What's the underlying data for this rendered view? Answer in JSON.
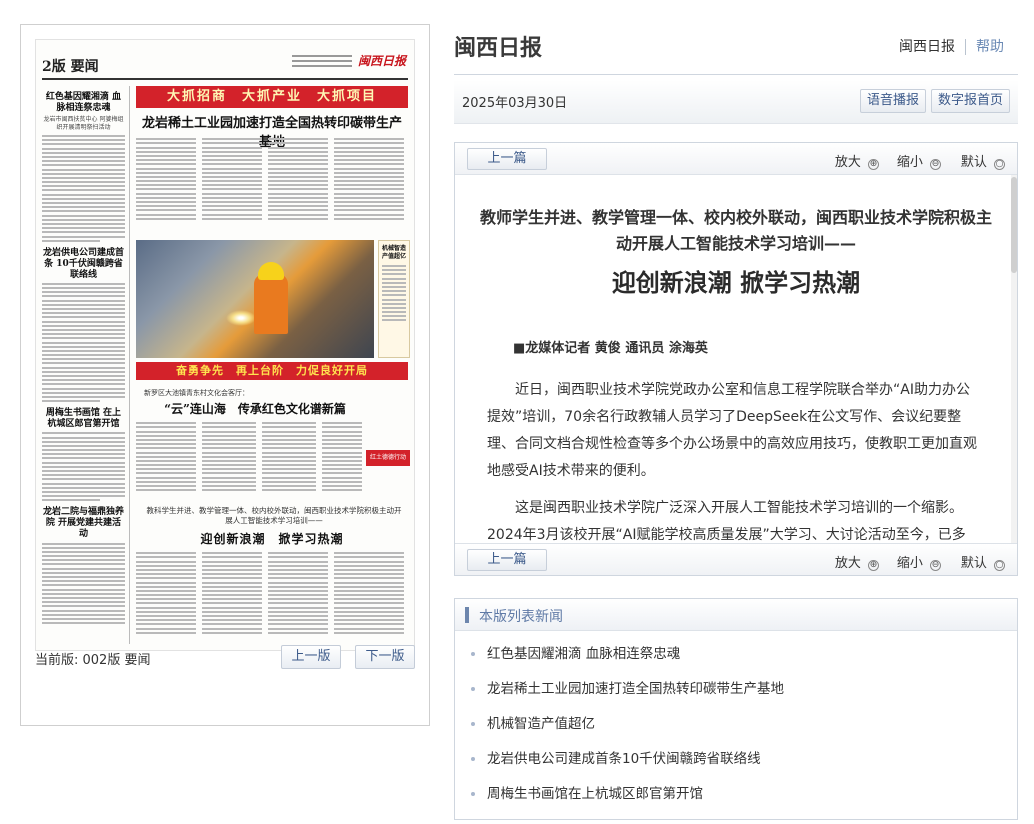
{
  "page_image": {
    "edition": "2版 要闻",
    "logo_text": "闽西日报",
    "col1_articles": [
      {
        "title": "红色基因耀湘滴 血脉相连祭忠魂",
        "sub": "龙岩市闽西扶贫中心 阿婆梅组织开展清明祭扫活动"
      },
      {
        "title": "龙岩供电公司建成首条 10千伏闽赣跨省联络线",
        "sub": ""
      },
      {
        "title": "周梅生书画馆 在上杭城区郎官第开馆",
        "sub": ""
      },
      {
        "title": "龙岩二院与福鼎独养院 开展党建共建活动",
        "sub": ""
      }
    ],
    "banner": "大抓招商　大抓产业　大抓项目",
    "headline": "龙岩稀土工业园加速打造全国热转印碳带生产基地",
    "sidebox": "机械智造产值超亿",
    "redbar": "奋勇争先　再上台阶　力促良好开局",
    "kicker": "新罗区大池镇青东村文化会客厅：",
    "headline2": "“云”连山海　传承红色文化谱新篇",
    "red_small": "红土德德行动",
    "kicker2": "教科学生并进、教学管理一体、校内校外联动，闽西职业技术学院积极主动开展人工智能技术学习培训——",
    "headline3": "迎创新浪潮　掀学习热潮"
  },
  "left_footer": {
    "current_label": "当前版: 002版 要闻",
    "prev_label": "上一版",
    "next_label": "下一版"
  },
  "header": {
    "brand": "闽西日报",
    "link1": "闽西日报",
    "link2": "帮助"
  },
  "datebar": {
    "date": "2025年03月30日",
    "voice_label": "语音播报",
    "home_label": "数字报首页"
  },
  "toolbar": {
    "prev_article": "上一篇",
    "zoom_in": "放大",
    "zoom_out": "缩小",
    "zoom_default": "默认",
    "zoom_in_icon": "⊕",
    "zoom_out_icon": "⊖",
    "zoom_default_icon": "○"
  },
  "article": {
    "pretitle": "教师学生并进、教学管理一体、校内校外联动，闽西职业技术学院积极主动开展人工智能技术学习培训——",
    "title": "迎创新浪潮 掀学习热潮",
    "byline": "■龙媒体记者 黄俊 通讯员 涂海英",
    "p1": "近日，闽西职业技术学院党政办公室和信息工程学院联合举办“AI助力办公提效”培训，70余名行政教辅人员学习了DeepSeek在公文写作、会议纪要整理、合同文档合规性检查等多个办公场景中的高效应用技巧，使教职工更加直观地感受AI技术带来的便利。",
    "p2": "这是闽西职业技术学院广泛深入开展人工智能技术学习培训的一个缩影。2024年3月该校开展“AI赋能学校高质量发展”大学习、大讨论活动至今，已多场"
  },
  "news_list": {
    "heading": "本版列表新闻",
    "items": [
      "红色基因耀湘滴 血脉相连祭忠魂",
      "龙岩稀土工业园加速打造全国热转印碳带生产基地",
      "机械智造产值超亿",
      "龙岩供电公司建成首条10千伏闽赣跨省联络线",
      "周梅生书画馆在上杭城区郎官第开馆"
    ]
  }
}
